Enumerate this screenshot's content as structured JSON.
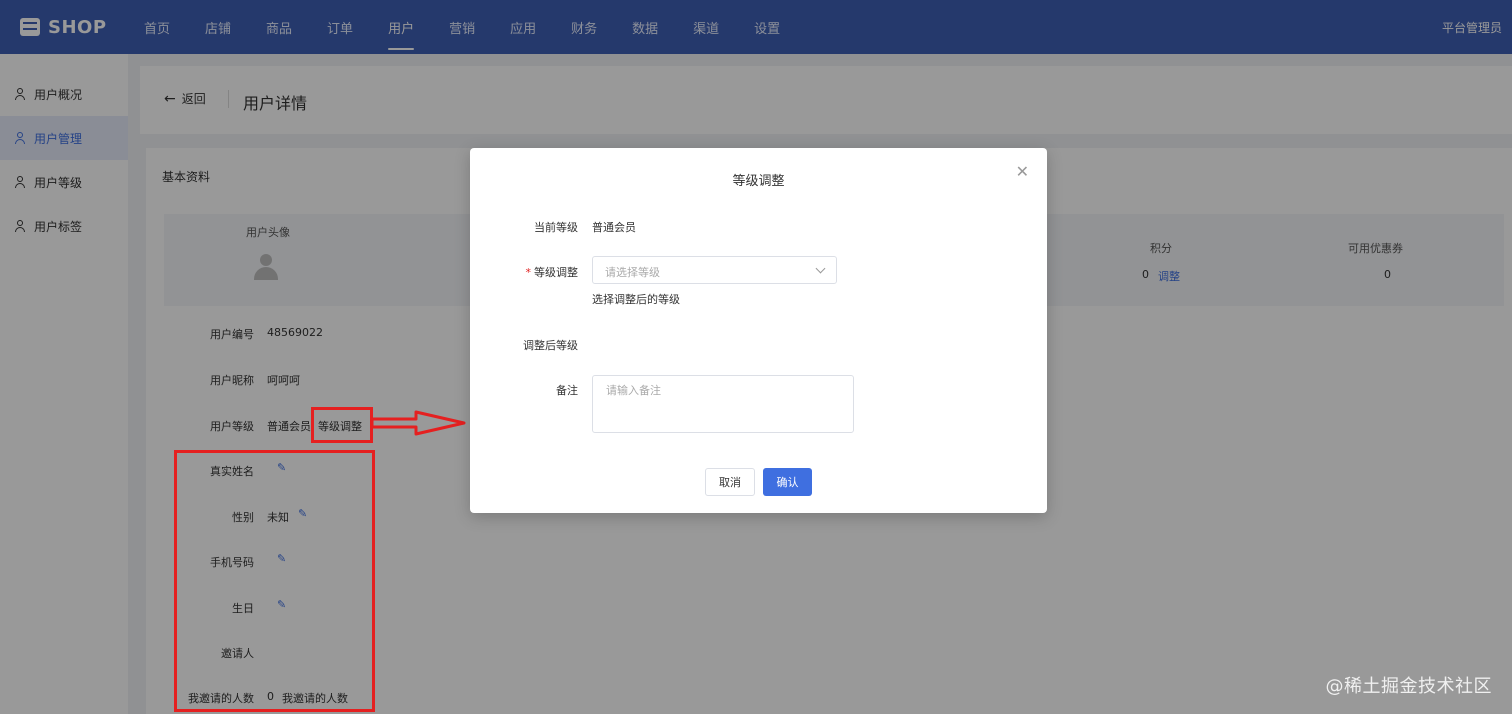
{
  "topbar": {
    "logo": "SHOP",
    "nav": [
      "首页",
      "店铺",
      "商品",
      "订单",
      "用户",
      "营销",
      "应用",
      "财务",
      "数据",
      "渠道",
      "设置"
    ],
    "active_nav": "用户",
    "admin": "平台管理员"
  },
  "sidebar": {
    "items": [
      {
        "label": "用户概况"
      },
      {
        "label": "用户管理"
      },
      {
        "label": "用户等级"
      },
      {
        "label": "用户标签"
      }
    ],
    "active": "用户管理"
  },
  "header": {
    "back": "返回",
    "title": "用户详情"
  },
  "info": {
    "section_title": "基本资料",
    "avatar_label": "用户头像",
    "points_label": "积分",
    "points_value": "0",
    "points_action": "调整",
    "coupon_label": "可用优惠券",
    "coupon_value": "0",
    "fields": {
      "user_id_label": "用户编号",
      "user_id": "48569022",
      "nickname_label": "用户昵称",
      "nickname": "呵呵呵",
      "level_label": "用户等级",
      "level": "普通会员",
      "level_action": "等级调整",
      "realname_label": "真实姓名",
      "gender_label": "性别",
      "gender": "未知",
      "phone_label": "手机号码",
      "birthday_label": "生日",
      "inviter_label": "邀请人",
      "invited_count_label": "我邀请的人数",
      "invited_count": "0",
      "invited_link": "我邀请的人数"
    }
  },
  "modal": {
    "title": "等级调整",
    "current_level_label": "当前等级",
    "current_level": "普通会员",
    "adjust_label": "等级调整",
    "select_placeholder": "请选择等级",
    "hint": "选择调整后的等级",
    "after_label": "调整后等级",
    "remark_label": "备注",
    "remark_placeholder": "请输入备注",
    "cancel": "取消",
    "confirm": "确认"
  },
  "colors": {
    "primary": "#3f6fe0",
    "topbar": "#3f5fb5",
    "annotation": "#e52020"
  },
  "watermark": "@稀土掘金技术社区"
}
